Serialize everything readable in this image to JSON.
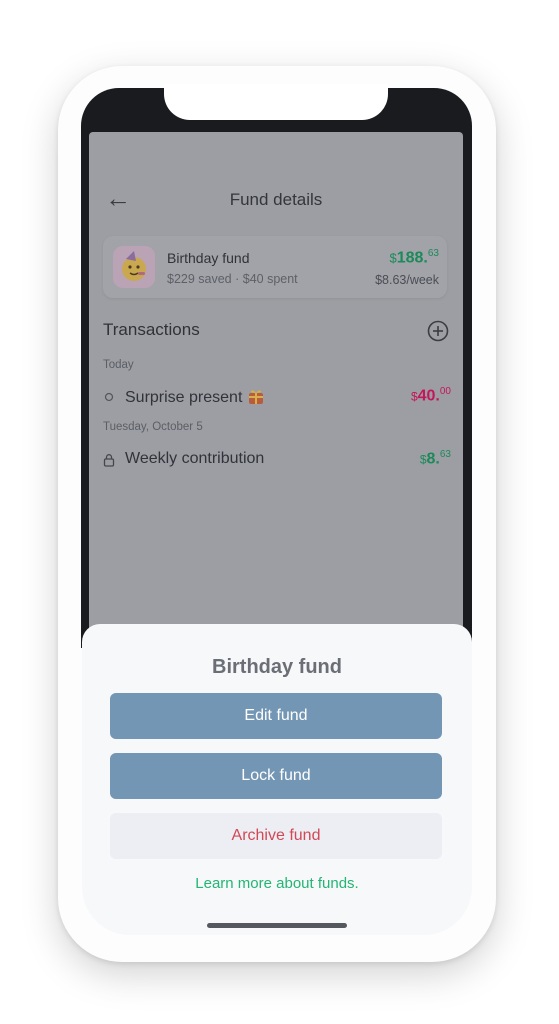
{
  "header": {
    "back_icon": "arrow-left-icon",
    "title": "Fund details"
  },
  "fund": {
    "icon": "party-face-emoji",
    "name": "Birthday fund",
    "summary": "$229 saved · $40 spent",
    "balance_currency": "$",
    "balance_whole": "188.",
    "balance_cents": "63",
    "rate": "$8.63/week"
  },
  "transactions": {
    "title": "Transactions",
    "add_icon": "plus-circle-icon",
    "groups": [
      {
        "date": "Today",
        "items": [
          {
            "icon": "circle-icon",
            "label": "Surprise present",
            "emoji": "gift-emoji",
            "currency": "$",
            "whole": "40.",
            "cents": "00",
            "color": "#c2185b"
          }
        ]
      },
      {
        "date": "Tuesday, October 5",
        "items": [
          {
            "icon": "lock-icon",
            "label": "Weekly contribution",
            "currency": "$",
            "whole": "8.",
            "cents": "63",
            "color": "#1b8a5a"
          }
        ]
      }
    ]
  },
  "sheet": {
    "title": "Birthday fund",
    "edit_label": "Edit fund",
    "lock_label": "Lock fund",
    "archive_label": "Archive fund",
    "learn_more": "Learn more about funds."
  },
  "colors": {
    "primary_button": "#7396b5",
    "archive_text": "#d24856",
    "link": "#23b573",
    "positive": "#1b8a5a",
    "negative": "#c2185b"
  }
}
